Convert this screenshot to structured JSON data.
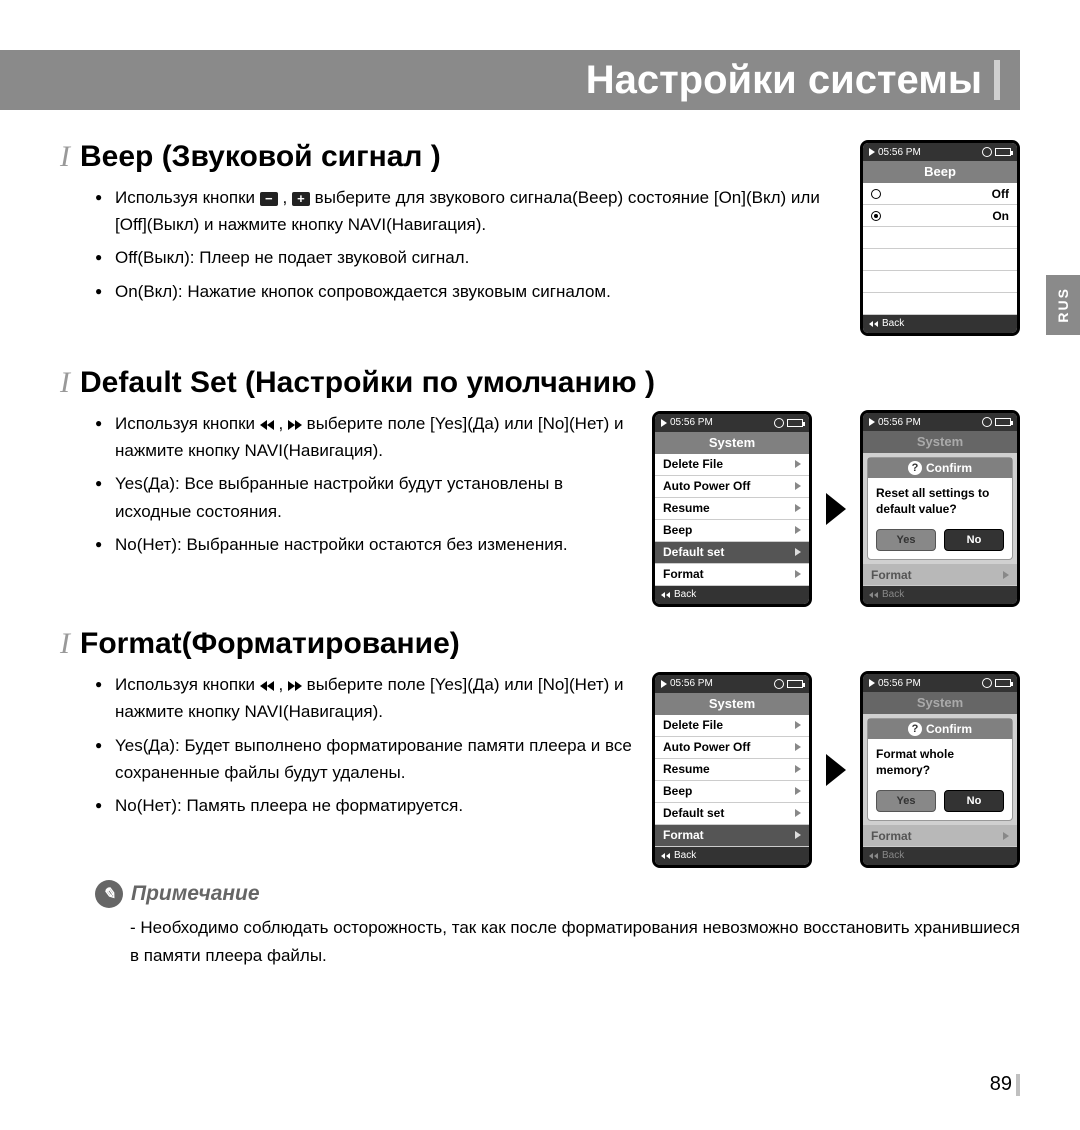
{
  "header": {
    "title": "Настройки системы"
  },
  "sidetab": "RUS",
  "page_number": "89",
  "section_beep": {
    "title": "Beep (Звуковой сигнал )",
    "bullets": [
      "Используя кнопки — , + выберите для звукового сигнала(Beep) состояние [On](Вкл) или [Off](Выкл) и нажмите кнопку NAVI(Навигация).",
      "Off(Выкл): Плеер не подает звуковой сигнал.",
      "On(Вкл): Нажатие кнопок сопровождается звуковым сигналом."
    ],
    "screen": {
      "time": "05:56 PM",
      "title": "Beep",
      "items": [
        "Off",
        "On"
      ],
      "back": "Back"
    }
  },
  "section_default": {
    "title": "Default Set (Настройки по умолчанию )",
    "bullets": [
      "Используя кнопки ⏮ , ⏭ выберите поле [Yes](Да) или [No](Нет) и нажмите кнопку NAVI(Навигация).",
      "Yes(Да): Все выбранные настройки будут установлены в исходные состояния.",
      "No(Нет): Выбранные настройки остаются без изменения."
    ],
    "screen1": {
      "time": "05:56 PM",
      "title": "System",
      "items": [
        "Delete File",
        "Auto Power Off",
        "Resume",
        "Beep",
        "Default set",
        "Format"
      ],
      "selected": "Default set",
      "back": "Back"
    },
    "screen2": {
      "time": "05:56 PM",
      "title": "System",
      "confirm": "Confirm",
      "dialog": "Reset all settings to default value?",
      "yes": "Yes",
      "no": "No",
      "format_row": "Format",
      "back": "Back"
    }
  },
  "section_format": {
    "title": "Format(Форматирование)",
    "bullets": [
      "Используя кнопки ⏮ , ⏭ выберите поле [Yes](Да) или [No](Нет) и нажмите кнопку NAVI(Навигация).",
      "Yes(Да): Будет выполнено форматирование памяти плеера и все сохраненные файлы будут удалены.",
      "No(Нет): Память плеера не форматируется."
    ],
    "screen1": {
      "time": "05:56 PM",
      "title": "System",
      "items": [
        "Delete File",
        "Auto Power Off",
        "Resume",
        "Beep",
        "Default set",
        "Format"
      ],
      "selected": "Format",
      "back": "Back"
    },
    "screen2": {
      "time": "05:56 PM",
      "title": "System",
      "confirm": "Confirm",
      "dialog": "Format whole memory?",
      "yes": "Yes",
      "no": "No",
      "format_row": "Format",
      "back": "Back"
    }
  },
  "note": {
    "title": "Примечание",
    "text": "- Необходимо соблюдать осторожность, так как после форматирования невозможно восстановить хранившиеся в памяти плеера файлы."
  }
}
